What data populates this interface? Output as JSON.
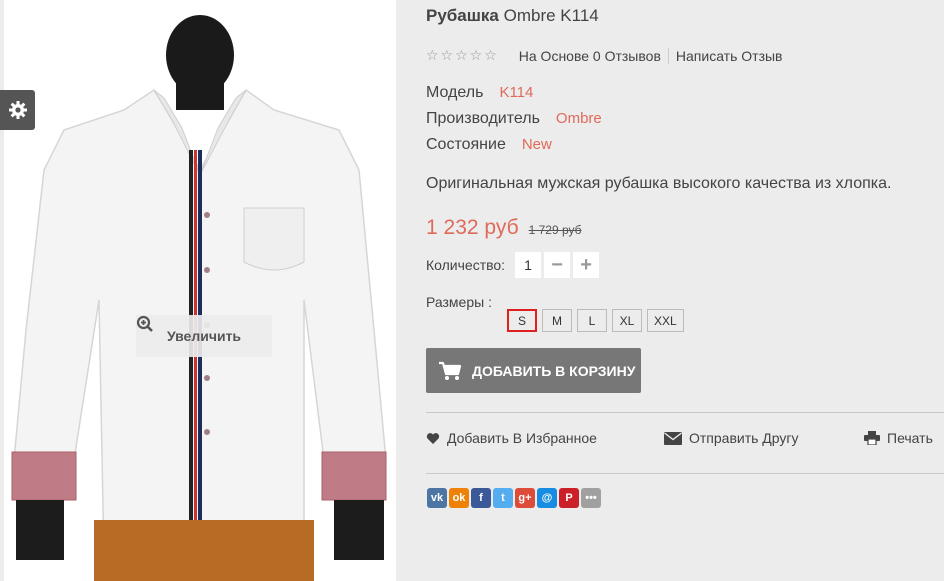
{
  "product": {
    "brand": "Рубашка",
    "name": "Ombre K114",
    "rating_stars": "☆☆☆☆☆",
    "reviews_link": "На Основе 0 Отзывов",
    "write_review_link": "Написать Отзыв",
    "model_label": "Модель",
    "model_value": "K114",
    "manufacturer_label": "Производитель",
    "manufacturer_value": "Ombre",
    "condition_label": "Состояние",
    "condition_value": "New",
    "description": "Оригинальная мужская рубашка высокого качества из хлопка.",
    "price": "1 232 руб",
    "old_price": "1 729 руб",
    "quantity_label": "Количество:",
    "quantity_value": "1",
    "minus_symbol": "−",
    "plus_symbol": "+",
    "sizes_label": "Размеры :",
    "sizes": [
      "S",
      "M",
      "L",
      "XL",
      "XXL"
    ],
    "selected_size": "S",
    "add_to_cart": "ДОБАВИТЬ В КОРЗИНУ"
  },
  "image": {
    "zoom_label": "Увеличить"
  },
  "actions": {
    "wishlist": "Добавить В Избранное",
    "send_friend": "Отправить Другу",
    "print": "Печать"
  },
  "social": [
    {
      "name": "vk",
      "label": "vk",
      "color": "#4d75a3"
    },
    {
      "name": "odnoklassniki",
      "label": "ok",
      "color": "#ee8208"
    },
    {
      "name": "facebook",
      "label": "f",
      "color": "#3b5998"
    },
    {
      "name": "twitter",
      "label": "t",
      "color": "#55acee"
    },
    {
      "name": "google-plus",
      "label": "g+",
      "color": "#dd4b39"
    },
    {
      "name": "mail",
      "label": "@",
      "color": "#168de2"
    },
    {
      "name": "pinterest",
      "label": "P",
      "color": "#cb2027"
    },
    {
      "name": "more",
      "label": "•••",
      "color": "#a0a0a0"
    }
  ],
  "colors": {
    "accent_red": "#e06a5a",
    "cart_button": "#777777",
    "selected_size_border": "#e02020"
  }
}
